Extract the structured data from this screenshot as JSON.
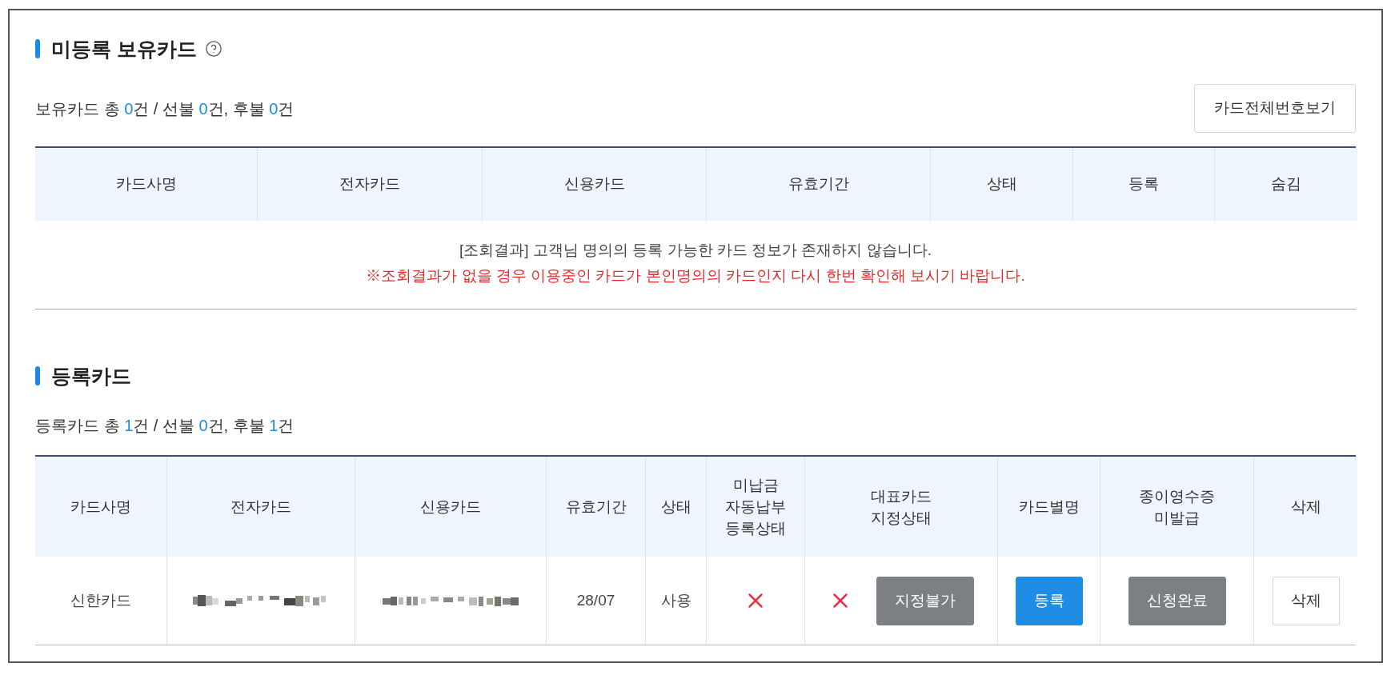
{
  "unregistered": {
    "title": "미등록 보유카드",
    "summary": [
      {
        "text": "보유카드 총 ",
        "accent": false
      },
      {
        "text": "0",
        "accent": true
      },
      {
        "text": "건 / 선불 ",
        "accent": false
      },
      {
        "text": "0",
        "accent": true
      },
      {
        "text": "건, 후불 ",
        "accent": false
      },
      {
        "text": "0",
        "accent": true
      },
      {
        "text": "건",
        "accent": false
      }
    ],
    "button": "카드전체번호보기",
    "table": {
      "columns": [
        "카드사명",
        "전자카드",
        "신용카드",
        "유효기간",
        "상태",
        "등록",
        "숨김"
      ],
      "message": "[조회결과] 고객님 명의의 등록 가능한 카드 정보가 존재하지 않습니다.",
      "notice": "※조회결과가 없을 경우 이용중인 카드가 본인명의의 카드인지 다시 한번 확인해 보시기 바랍니다."
    }
  },
  "registered": {
    "title": "등록카드",
    "summary": [
      {
        "text": "등록카드 총 ",
        "accent": false
      },
      {
        "text": "1",
        "accent": true
      },
      {
        "text": "건 / 선불 ",
        "accent": false
      },
      {
        "text": "0",
        "accent": true
      },
      {
        "text": "건, 후불 ",
        "accent": false
      },
      {
        "text": "1",
        "accent": true
      },
      {
        "text": "건",
        "accent": false
      }
    ],
    "table": {
      "columns": [
        "카드사명",
        "전자카드",
        "신용카드",
        "유효기간",
        "상태",
        "미납금\n자동납부\n등록상태",
        "대표카드\n지정상태",
        "카드별명",
        "종이영수증\n미발급",
        "삭제"
      ],
      "rows": [
        {
          "cells": [
            {
              "kind": "text",
              "text": "신한카드"
            },
            {
              "kind": "masked"
            },
            {
              "kind": "masked"
            },
            {
              "kind": "text",
              "text": "28/07"
            },
            {
              "kind": "text",
              "text": "사용"
            },
            {
              "kind": "mark",
              "checked": false
            },
            {
              "kind": "mark",
              "checked": false,
              "button": {
                "label": "지정불가",
                "kind": "muted"
              }
            },
            {
              "kind": "button",
              "button": {
                "label": "등록",
                "kind": "primary"
              }
            },
            {
              "kind": "button",
              "button": {
                "label": "신청완료",
                "kind": "muted"
              }
            },
            {
              "kind": "button",
              "button": {
                "label": "삭제",
                "kind": "outline"
              }
            }
          ]
        }
      ]
    }
  }
}
